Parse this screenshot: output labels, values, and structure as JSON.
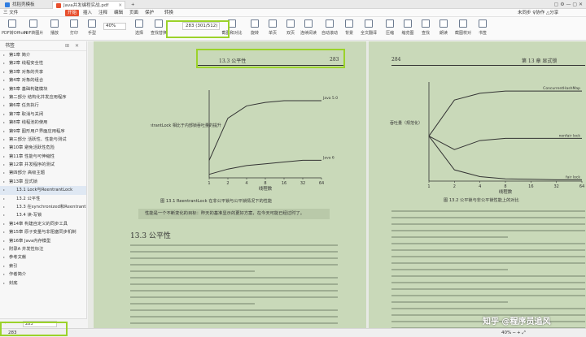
{
  "tabs": {
    "first": "找稻壳模板",
    "second": "Java并发编程实战.pdf",
    "add": "+"
  },
  "window_icons": "▢  ⚙  —  ▢  ✕",
  "menu": {
    "items": [
      "三 文件",
      "开始",
      "插入",
      "注释",
      "编辑",
      "页面",
      "保护",
      "转换"
    ],
    "right": "未同步 ♀协作 △分享"
  },
  "toolbar": {
    "tools": [
      "PDF转Office▾",
      "PDF转图片",
      "播放",
      "打印",
      "手型",
      "选择",
      "查找替换",
      "截图和对比",
      "旋转",
      "单页",
      "双页",
      "连续阅读",
      "自动滚动",
      "背景",
      "全文翻译",
      "压缩",
      "缩览图",
      "查找",
      "朗读",
      "截图校对",
      "书签"
    ],
    "zoom": "40%",
    "page_input": "283 (301/512)"
  },
  "sidebar": {
    "title": "书签",
    "items": [
      "第1章 简介",
      "第2章 线程安全性",
      "第3章 对象的共享",
      "第4章 对象的组合",
      "第5章 基础构建模块",
      "第二部分 结构化并发应用程序",
      "第6章 任务执行",
      "第7章 取消与关闭",
      "第8章 线程池的使用",
      "第9章 图形用户界面应用程序",
      "第三部分 活跃性、性能与测试",
      "第10章 避免活跃性危险",
      "第11章 性能与可伸缩性",
      "第12章 并发程序的测试",
      "第四部分 高级主题",
      "第13章 显式锁",
      "13.1 Lock与ReentrantLock",
      "13.2 公平性",
      "13.3 在synchronized和ReentrantLock之间进行选择",
      "13.4 读-写锁",
      "第14章 构建自定义的同步工具",
      "第15章 原子变量与非阻塞同步机制",
      "第16章 Java内存模型",
      "附录A 并发性标注",
      "参考文献",
      "索引",
      "作者简介",
      "封底"
    ],
    "selected_index": 16,
    "footer_page": "283"
  },
  "left_page": {
    "header_section": "13.3   公平性",
    "header_page": "283",
    "figure_caption": "图 13.1   ReentrantLock 在非公平锁与公平锁情况下的性能",
    "quote": "性能是一个不断变化的目标：昨天的基准显示的更好方案，在今天可能已经过时了。",
    "section_title": "13.3  公平性",
    "chart_ylabel": "ReentrantLock 相比于内部锁吞吐量的提升",
    "chart_xlabel": "线程数"
  },
  "right_page": {
    "header_page": "284",
    "header_chapter": "第 13 章   显式锁",
    "figure_caption": "图 13.2   公平锁与非公平锁性能上的对比",
    "chart_ylabel": "吞吐量（规范化）",
    "chart_xlabel": "线程数",
    "series_labels": [
      "ConcurrentHashMap",
      "nonfair lock",
      "fair lock"
    ]
  },
  "statusbar": {
    "left": "283",
    "right": "40% ─  +  ⤢"
  },
  "watermark": "知乎 @程序员追风",
  "chart_data": [
    {
      "type": "line",
      "x": [
        1,
        2,
        4,
        8,
        16,
        32,
        64
      ],
      "series": [
        {
          "name": "Java 5.0",
          "values": [
            1.0,
            3.4,
            4.1,
            4.3,
            4.4,
            4.4,
            4.4
          ]
        },
        {
          "name": "Java 6",
          "values": [
            0.2,
            0.5,
            0.7,
            0.8,
            0.9,
            1.0,
            1.0
          ]
        }
      ],
      "xlabel": "线程数",
      "ylabel": "ReentrantLock 相比于内部锁吞吐量的提升",
      "ylim": [
        0,
        5
      ]
    },
    {
      "type": "line",
      "x": [
        1,
        2,
        4,
        8,
        16,
        32,
        64
      ],
      "series": [
        {
          "name": "ConcurrentHashMap",
          "values": [
            1.0,
            1.8,
            1.95,
            2.0,
            2.0,
            2.0,
            2.0
          ]
        },
        {
          "name": "nonfair lock",
          "values": [
            1.0,
            0.7,
            0.9,
            0.95,
            0.95,
            0.95,
            0.95
          ]
        },
        {
          "name": "fair lock",
          "values": [
            1.0,
            0.25,
            0.1,
            0.05,
            0.04,
            0.03,
            0.03
          ]
        }
      ],
      "xlabel": "线程数",
      "ylabel": "吞吐量（规范化）",
      "ylim": [
        0,
        2.2
      ]
    }
  ]
}
